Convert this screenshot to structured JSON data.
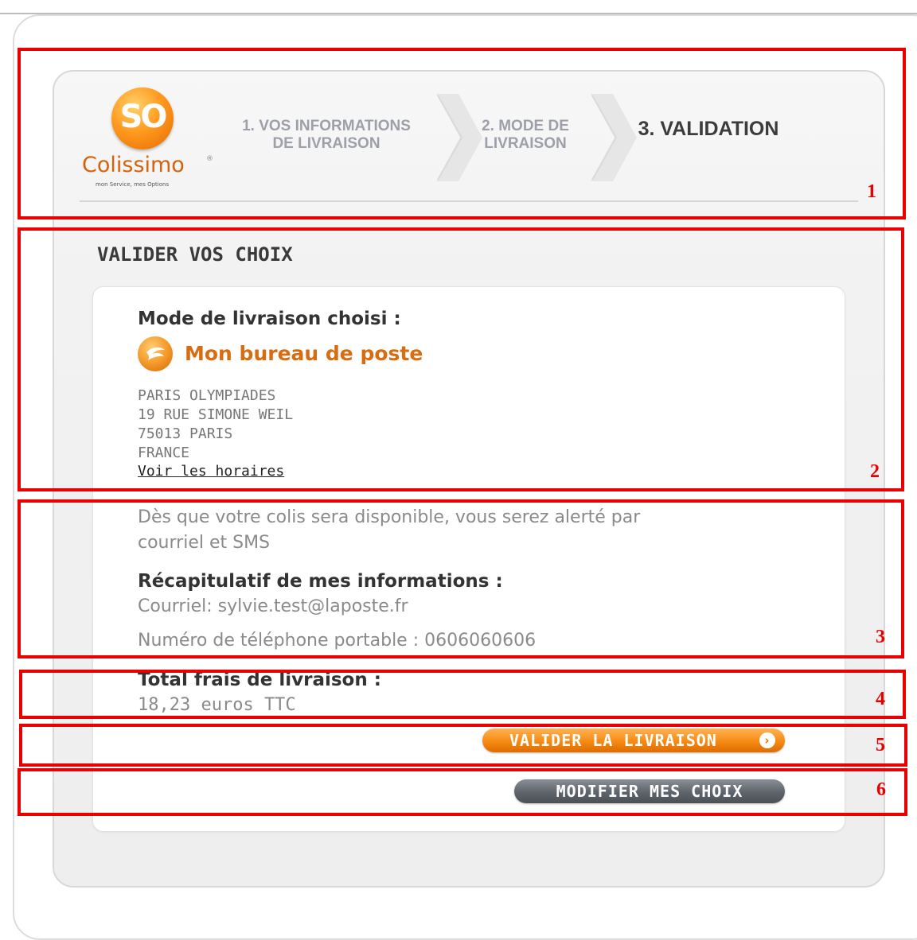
{
  "brand": {
    "logo_mark": "SO",
    "logo_name": "Colissimo",
    "logo_tagline": "mon Service, mes Options"
  },
  "steps": [
    {
      "line1": "1. VOS INFORMATIONS",
      "line2": "DE LIVRAISON",
      "active": false
    },
    {
      "line1": "2. MODE DE",
      "line2": "LIVRAISON",
      "active": false
    },
    {
      "line1": "3. VALIDATION",
      "line2": "",
      "active": true
    }
  ],
  "page": {
    "title": "VALIDER VOS CHOIX"
  },
  "delivery": {
    "mode_label": "Mode de livraison choisi :",
    "option_icon": "la-poste-icon",
    "option_name": "Mon bureau de poste",
    "address": [
      "PARIS OLYMPIADES",
      "19 RUE SIMONE WEIL",
      "75013 PARIS",
      "FRANCE"
    ],
    "hours_link": "Voir les horaires"
  },
  "alert": {
    "line1": "Dès que votre colis sera disponible, vous serez alerté par",
    "line2": "courriel et SMS"
  },
  "recap": {
    "label": "Récapitulatif de mes informations :",
    "email": "Courriel: sylvie.test@laposte.fr",
    "phone": "Numéro de téléphone portable : 0606060606"
  },
  "total": {
    "label": "Total frais de livraison :",
    "value": "18,23 euros TTC"
  },
  "buttons": {
    "validate": "VALIDER LA LIVRAISON",
    "modify": "MODIFIER MES CHOIX"
  },
  "annotations": [
    "1",
    "2",
    "3",
    "4",
    "5",
    "6"
  ],
  "colors": {
    "brand_orange": "#d76c10",
    "annotation_red": "#ea0000",
    "button_gray": "#5e646b"
  }
}
